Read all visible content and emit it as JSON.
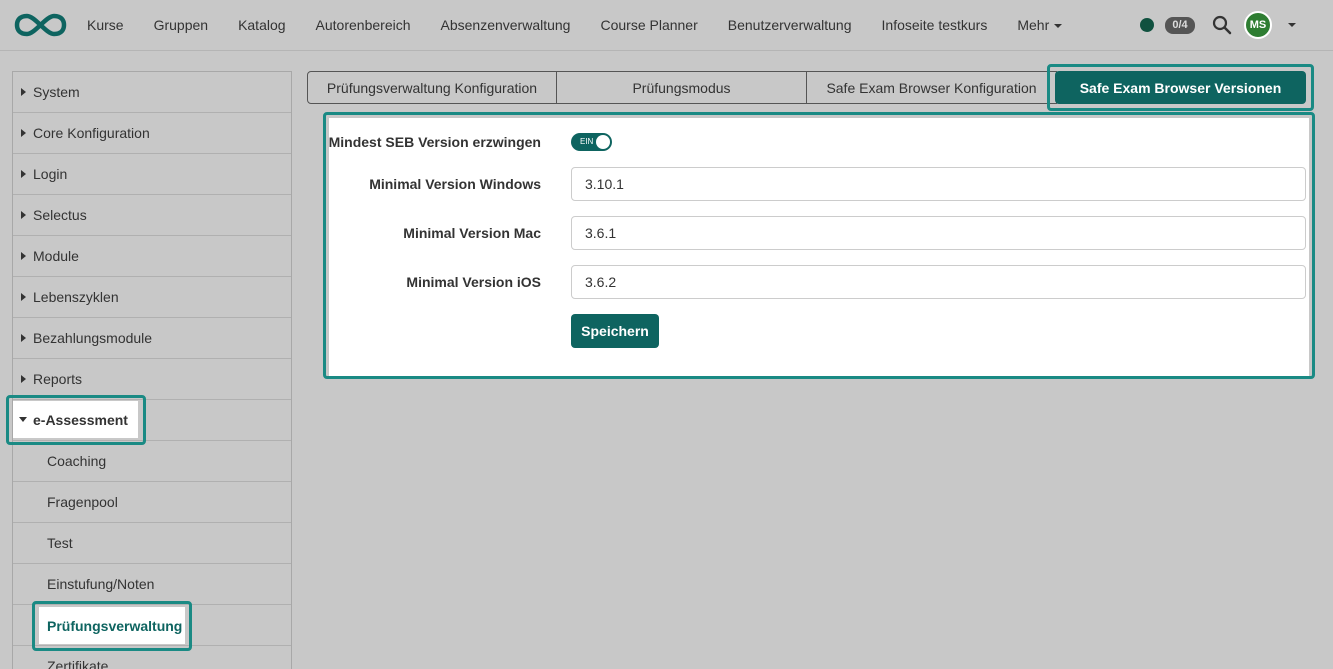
{
  "nav": {
    "items": [
      "Kurse",
      "Gruppen",
      "Katalog",
      "Autorenbereich",
      "Absenzenverwaltung",
      "Course Planner",
      "Benutzerverwaltung",
      "Infoseite testkurs",
      "Mehr"
    ],
    "badge": "0/4",
    "avatar": "MS"
  },
  "sidebar": {
    "items": [
      "System",
      "Core Konfiguration",
      "Login",
      "Selectus",
      "Module",
      "Lebenszyklen",
      "Bezahlungsmodule",
      "Reports"
    ],
    "expanded": "e-Assessment",
    "subitems": [
      "Coaching",
      "Fragenpool",
      "Test",
      "Einstufung/Noten"
    ],
    "active_sub": "Prüfungsverwaltung",
    "after_active": "Zertifikate"
  },
  "tabs": {
    "items": [
      "Prüfungsverwaltung Konfiguration",
      "Prüfungsmodus",
      "Safe Exam Browser Konfiguration"
    ],
    "active": "Safe Exam Browser Versionen"
  },
  "form": {
    "toggle_label": "Mindest SEB Version erzwingen",
    "toggle_text": "EIN",
    "windows_label": "Minimal Version Windows",
    "windows_value": "3.10.1",
    "mac_label": "Minimal Version Mac",
    "mac_value": "3.6.1",
    "ios_label": "Minimal Version iOS",
    "ios_value": "3.6.2",
    "save_label": "Speichern"
  },
  "colors": {
    "accent": "#0e6460",
    "highlight": "#1a8a84",
    "status": "#10513f"
  }
}
